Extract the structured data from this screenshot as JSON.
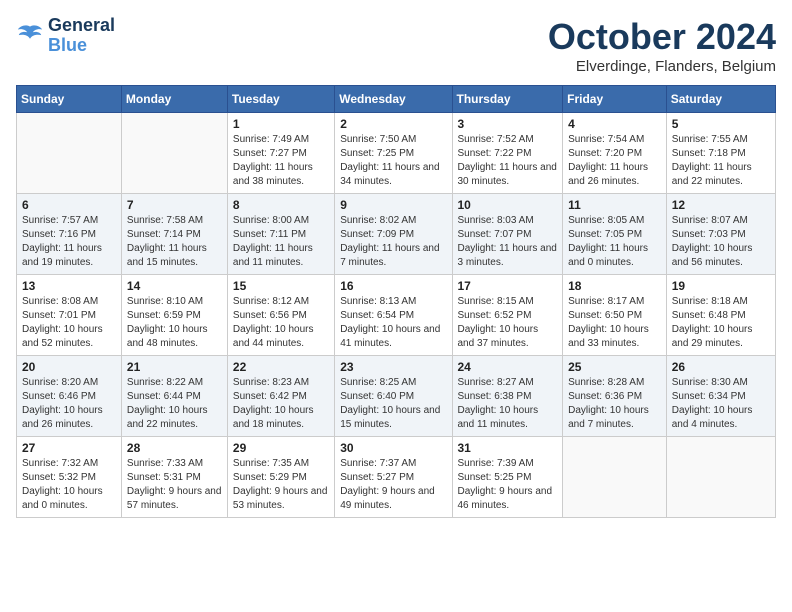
{
  "header": {
    "logo_line1": "General",
    "logo_line2": "Blue",
    "title": "October 2024",
    "location": "Elverdinge, Flanders, Belgium"
  },
  "days_of_week": [
    "Sunday",
    "Monday",
    "Tuesday",
    "Wednesday",
    "Thursday",
    "Friday",
    "Saturday"
  ],
  "weeks": [
    [
      {
        "day": "",
        "info": ""
      },
      {
        "day": "",
        "info": ""
      },
      {
        "day": "1",
        "info": "Sunrise: 7:49 AM\nSunset: 7:27 PM\nDaylight: 11 hours and 38 minutes."
      },
      {
        "day": "2",
        "info": "Sunrise: 7:50 AM\nSunset: 7:25 PM\nDaylight: 11 hours and 34 minutes."
      },
      {
        "day": "3",
        "info": "Sunrise: 7:52 AM\nSunset: 7:22 PM\nDaylight: 11 hours and 30 minutes."
      },
      {
        "day": "4",
        "info": "Sunrise: 7:54 AM\nSunset: 7:20 PM\nDaylight: 11 hours and 26 minutes."
      },
      {
        "day": "5",
        "info": "Sunrise: 7:55 AM\nSunset: 7:18 PM\nDaylight: 11 hours and 22 minutes."
      }
    ],
    [
      {
        "day": "6",
        "info": "Sunrise: 7:57 AM\nSunset: 7:16 PM\nDaylight: 11 hours and 19 minutes."
      },
      {
        "day": "7",
        "info": "Sunrise: 7:58 AM\nSunset: 7:14 PM\nDaylight: 11 hours and 15 minutes."
      },
      {
        "day": "8",
        "info": "Sunrise: 8:00 AM\nSunset: 7:11 PM\nDaylight: 11 hours and 11 minutes."
      },
      {
        "day": "9",
        "info": "Sunrise: 8:02 AM\nSunset: 7:09 PM\nDaylight: 11 hours and 7 minutes."
      },
      {
        "day": "10",
        "info": "Sunrise: 8:03 AM\nSunset: 7:07 PM\nDaylight: 11 hours and 3 minutes."
      },
      {
        "day": "11",
        "info": "Sunrise: 8:05 AM\nSunset: 7:05 PM\nDaylight: 11 hours and 0 minutes."
      },
      {
        "day": "12",
        "info": "Sunrise: 8:07 AM\nSunset: 7:03 PM\nDaylight: 10 hours and 56 minutes."
      }
    ],
    [
      {
        "day": "13",
        "info": "Sunrise: 8:08 AM\nSunset: 7:01 PM\nDaylight: 10 hours and 52 minutes."
      },
      {
        "day": "14",
        "info": "Sunrise: 8:10 AM\nSunset: 6:59 PM\nDaylight: 10 hours and 48 minutes."
      },
      {
        "day": "15",
        "info": "Sunrise: 8:12 AM\nSunset: 6:56 PM\nDaylight: 10 hours and 44 minutes."
      },
      {
        "day": "16",
        "info": "Sunrise: 8:13 AM\nSunset: 6:54 PM\nDaylight: 10 hours and 41 minutes."
      },
      {
        "day": "17",
        "info": "Sunrise: 8:15 AM\nSunset: 6:52 PM\nDaylight: 10 hours and 37 minutes."
      },
      {
        "day": "18",
        "info": "Sunrise: 8:17 AM\nSunset: 6:50 PM\nDaylight: 10 hours and 33 minutes."
      },
      {
        "day": "19",
        "info": "Sunrise: 8:18 AM\nSunset: 6:48 PM\nDaylight: 10 hours and 29 minutes."
      }
    ],
    [
      {
        "day": "20",
        "info": "Sunrise: 8:20 AM\nSunset: 6:46 PM\nDaylight: 10 hours and 26 minutes."
      },
      {
        "day": "21",
        "info": "Sunrise: 8:22 AM\nSunset: 6:44 PM\nDaylight: 10 hours and 22 minutes."
      },
      {
        "day": "22",
        "info": "Sunrise: 8:23 AM\nSunset: 6:42 PM\nDaylight: 10 hours and 18 minutes."
      },
      {
        "day": "23",
        "info": "Sunrise: 8:25 AM\nSunset: 6:40 PM\nDaylight: 10 hours and 15 minutes."
      },
      {
        "day": "24",
        "info": "Sunrise: 8:27 AM\nSunset: 6:38 PM\nDaylight: 10 hours and 11 minutes."
      },
      {
        "day": "25",
        "info": "Sunrise: 8:28 AM\nSunset: 6:36 PM\nDaylight: 10 hours and 7 minutes."
      },
      {
        "day": "26",
        "info": "Sunrise: 8:30 AM\nSunset: 6:34 PM\nDaylight: 10 hours and 4 minutes."
      }
    ],
    [
      {
        "day": "27",
        "info": "Sunrise: 7:32 AM\nSunset: 5:32 PM\nDaylight: 10 hours and 0 minutes."
      },
      {
        "day": "28",
        "info": "Sunrise: 7:33 AM\nSunset: 5:31 PM\nDaylight: 9 hours and 57 minutes."
      },
      {
        "day": "29",
        "info": "Sunrise: 7:35 AM\nSunset: 5:29 PM\nDaylight: 9 hours and 53 minutes."
      },
      {
        "day": "30",
        "info": "Sunrise: 7:37 AM\nSunset: 5:27 PM\nDaylight: 9 hours and 49 minutes."
      },
      {
        "day": "31",
        "info": "Sunrise: 7:39 AM\nSunset: 5:25 PM\nDaylight: 9 hours and 46 minutes."
      },
      {
        "day": "",
        "info": ""
      },
      {
        "day": "",
        "info": ""
      }
    ]
  ]
}
